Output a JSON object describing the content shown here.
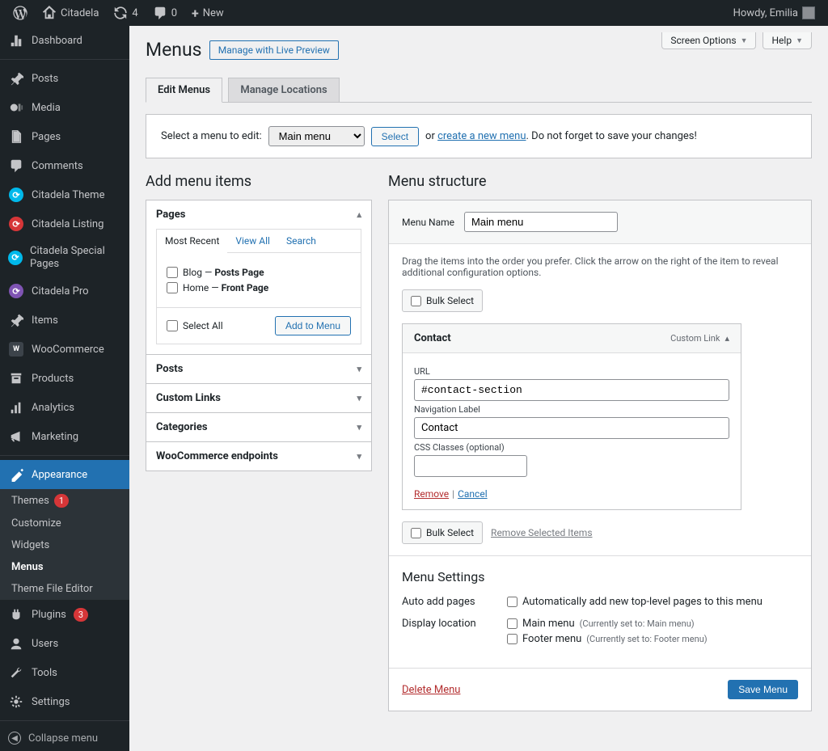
{
  "adminbar": {
    "site": "Citadela",
    "updates": "4",
    "comments": "0",
    "new": "New",
    "howdy": "Howdy, Emilia"
  },
  "sidebar": {
    "items": [
      {
        "label": "Dashboard",
        "icon": "dashboard"
      },
      {
        "label": "Posts",
        "icon": "pin"
      },
      {
        "label": "Media",
        "icon": "media"
      },
      {
        "label": "Pages",
        "icon": "pages"
      },
      {
        "label": "Comments",
        "icon": "comments"
      },
      {
        "label": "Citadela Theme",
        "icon": "ci-blue"
      },
      {
        "label": "Citadela Listing",
        "icon": "ci-red"
      },
      {
        "label": "Citadela Special Pages",
        "icon": "ci-blue"
      },
      {
        "label": "Citadela Pro",
        "icon": "ci-purple"
      },
      {
        "label": "Items",
        "icon": "pin"
      },
      {
        "label": "WooCommerce",
        "icon": "woo"
      },
      {
        "label": "Products",
        "icon": "products"
      },
      {
        "label": "Analytics",
        "icon": "analytics"
      },
      {
        "label": "Marketing",
        "icon": "marketing"
      },
      {
        "label": "Appearance",
        "icon": "appearance",
        "current": true
      },
      {
        "label": "Plugins",
        "icon": "plugins",
        "badge": "3"
      },
      {
        "label": "Users",
        "icon": "users"
      },
      {
        "label": "Tools",
        "icon": "tools"
      },
      {
        "label": "Settings",
        "icon": "settings"
      }
    ],
    "submenu": [
      {
        "label": "Themes",
        "badge": "1"
      },
      {
        "label": "Customize"
      },
      {
        "label": "Widgets"
      },
      {
        "label": "Menus",
        "current": true
      },
      {
        "label": "Theme File Editor"
      }
    ],
    "collapse": "Collapse menu"
  },
  "top": {
    "screen_options": "Screen Options",
    "help": "Help"
  },
  "page": {
    "title": "Menus",
    "title_action": "Manage with Live Preview",
    "tabs": {
      "edit": "Edit Menus",
      "locations": "Manage Locations"
    },
    "select_label": "Select a menu to edit:",
    "select_value": "Main menu",
    "select_btn": "Select",
    "or": "or",
    "create_link": "create a new menu",
    "dont_forget": ". Do not forget to save your changes!"
  },
  "left": {
    "heading": "Add menu items",
    "pages": {
      "title": "Pages",
      "tabs": {
        "recent": "Most Recent",
        "all": "View All",
        "search": "Search"
      },
      "items": [
        {
          "name": "Blog",
          "suffix": "Posts Page"
        },
        {
          "name": "Home",
          "suffix": "Front Page"
        }
      ],
      "select_all": "Select All",
      "add_btn": "Add to Menu"
    },
    "posts": "Posts",
    "custom_links": "Custom Links",
    "categories": "Categories",
    "woo": "WooCommerce endpoints"
  },
  "right": {
    "heading": "Menu structure",
    "name_label": "Menu Name",
    "name_value": "Main menu",
    "desc": "Drag the items into the order you prefer. Click the arrow on the right of the item to reveal additional configuration options.",
    "bulk": "Bulk Select",
    "item": {
      "title": "Contact",
      "type": "Custom Link",
      "url_label": "URL",
      "url_value": "#contact-section",
      "nav_label": "Navigation Label",
      "nav_value": "Contact",
      "css_label": "CSS Classes (optional)",
      "css_value": "",
      "remove": "Remove",
      "cancel": "Cancel"
    },
    "remove_selected": "Remove Selected Items",
    "settings": {
      "title": "Menu Settings",
      "auto_label": "Auto add pages",
      "auto_opt": "Automatically add new top-level pages to this menu",
      "loc_label": "Display location",
      "loc_main": "Main menu",
      "loc_main_note": "(Currently set to: Main menu)",
      "loc_footer": "Footer menu",
      "loc_footer_note": "(Currently set to: Footer menu)"
    },
    "delete": "Delete Menu",
    "save": "Save Menu"
  }
}
